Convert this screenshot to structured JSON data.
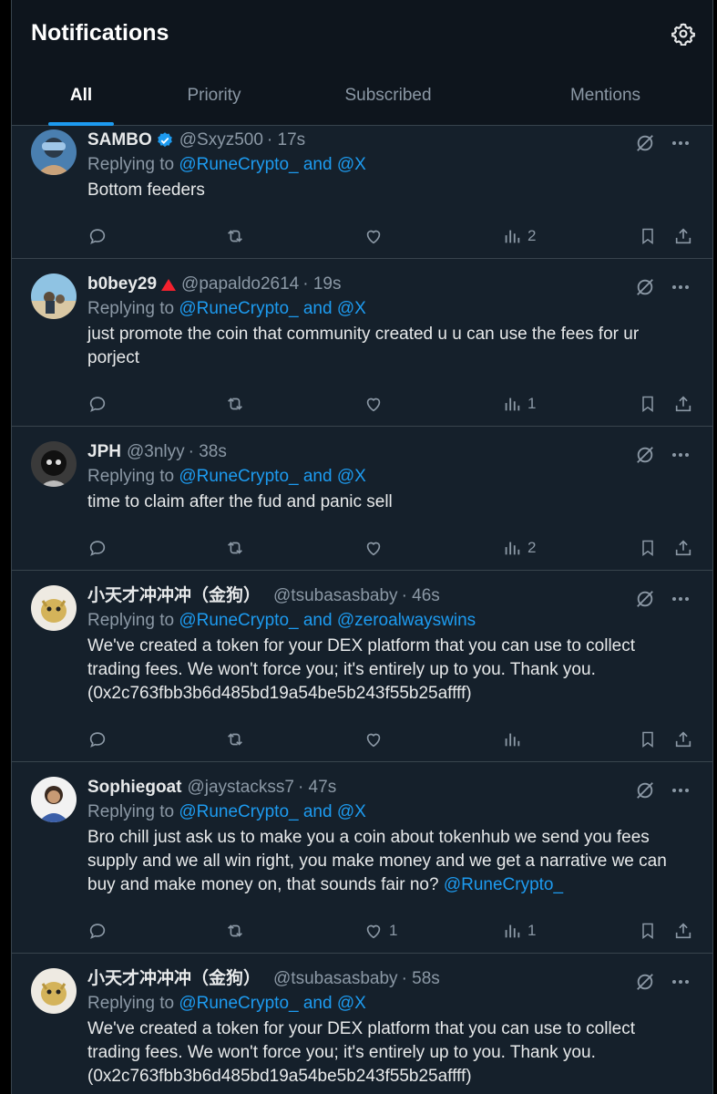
{
  "header": {
    "title": "Notifications",
    "settings_icon": "gear-icon",
    "tabs": [
      {
        "label": "All",
        "active": true
      },
      {
        "label": "Priority",
        "active": false
      },
      {
        "label": "Subscribed",
        "active": false
      },
      {
        "label": "Mentions",
        "active": false
      }
    ]
  },
  "colors": {
    "accent": "#1d9bf0",
    "background": "#15202b",
    "muted": "#8b98a5",
    "text": "#e7e9ea"
  },
  "tweets": [
    {
      "name": "SAMBO",
      "verified": true,
      "handle": "@Sxyz500",
      "time": "· 17s",
      "replying_prefix": "Replying to",
      "replying_to": "@RuneCrypto_ and @X",
      "text": "Bottom feeders",
      "likes": "",
      "views": "2"
    },
    {
      "name": "b0bey29",
      "handle": "@papaldo2614",
      "time": "· 19s",
      "replying_prefix": "Replying to",
      "replying_to": "@RuneCrypto_ and @X",
      "text": "just promote the coin that community created u u can use the fees for ur porject",
      "likes": "",
      "views": "1"
    },
    {
      "name": "JPH",
      "handle": "@3nlyy",
      "time": "· 38s",
      "replying_prefix": "Replying to",
      "replying_to": "@RuneCrypto_ and @X",
      "text": "time to claim after the fud and panic sell",
      "likes": "",
      "views": "2"
    },
    {
      "name": "小天才冲冲冲（金狗）",
      "handle": "@tsubasasbaby",
      "time": "· 46s",
      "replying_prefix": "Replying to",
      "replying_to": "@RuneCrypto_ and @zeroalwayswins",
      "text": "We've created a token for your DEX platform that you can use to collect trading fees. We won't force you; it's entirely up to you. Thank you. (0x2c763fbb3b6d485bd19a54be5b243f55b25affff)",
      "likes": "",
      "views": ""
    },
    {
      "name": "Sophiegoat",
      "handle": "@jaystackss7",
      "time": "· 47s",
      "replying_prefix": "Replying to",
      "replying_to": "@RuneCrypto_ and @X",
      "text": "Bro chill just ask us to make you a coin about tokenhub we send you fees supply and we all win right, you make money and we get a narrative we can buy and make money on, that sounds fair no?",
      "text_mention": "@RuneCrypto_",
      "likes": "1",
      "views": "1"
    },
    {
      "name": "小天才冲冲冲（金狗）",
      "handle": "@tsubasasbaby",
      "time": "· 58s",
      "replying_prefix": "Replying to",
      "replying_to": "@RuneCrypto_ and @X",
      "text": "We've created a token for your DEX platform that you can use to collect trading fees. We won't force you; it's entirely up to you. Thank you. (0x2c763fbb3b6d485bd19a54be5b243f55b25affff)",
      "likes": "",
      "views": ""
    }
  ]
}
